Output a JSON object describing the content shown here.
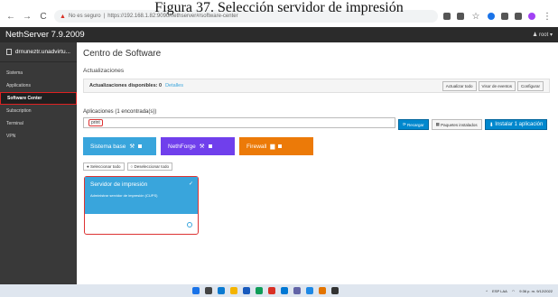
{
  "caption": "Figura 37. Selección servidor de impresión",
  "browser": {
    "url_warning": "No es seguro",
    "url": "https://192.168.1.82:9090/nethserver#/software-center"
  },
  "topbar": {
    "product": "NethServer 7.9.2009",
    "user": "root"
  },
  "sidebar": {
    "host": "drnuneztr.unadvirtu...",
    "items": [
      "Sistema",
      "Applications",
      "Software Center",
      "Subscription",
      "Terminal",
      "VPN"
    ],
    "active_index": 2
  },
  "main": {
    "title": "Centro de Software",
    "subtitle": "Actualizaciones",
    "updates_label": "Actualizaciones disponibles: 0",
    "details_link": "Detalles",
    "update_buttons": [
      "Actualizar todo",
      "Visor de eventos",
      "Configurar"
    ],
    "apps_title": "Aplicaciones (1 encontrada(s))",
    "search_value": "print",
    "reload": "Recargar",
    "installed": "Paquetes instalados",
    "install": "Instalar 1 aplicación",
    "categories": [
      "Sistema base",
      "NethForge",
      "Firewall"
    ],
    "select_all": "Seleccionar todo",
    "deselect_all": "Deseleccionar todo",
    "card_title": "Servidor de impresión",
    "card_desc": "Administrar servidor de impresión (CUPS)"
  },
  "taskbar": {
    "lang": "ESP LAA",
    "time": "9:36 p. m.",
    "date": "9/12/2022"
  }
}
